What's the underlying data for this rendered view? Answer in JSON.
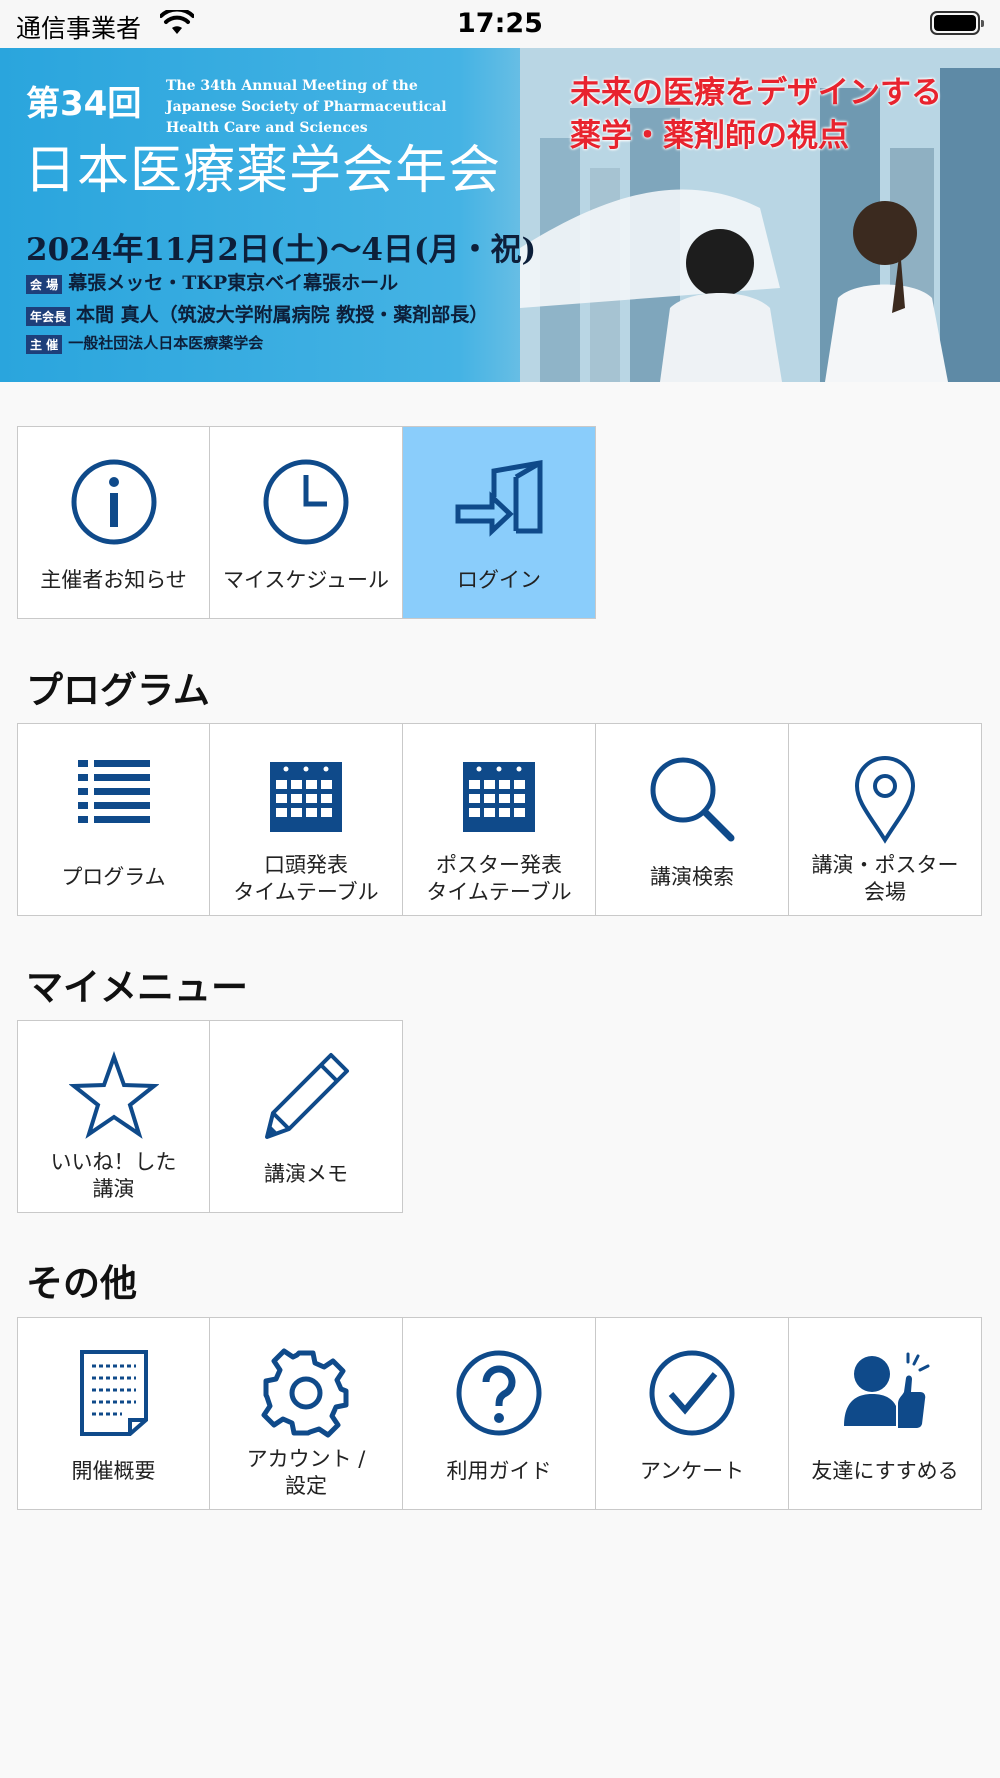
{
  "status_bar": {
    "carrier": "通信事業者",
    "time": "17:25"
  },
  "banner": {
    "edition": "第34回",
    "english_title": "The 34th Annual Meeting of the Japanese Society of Pharmaceutical Health Care and Sciences",
    "title": "日本医療薬学会年会",
    "date": "2024年11月2日(土)～4日(月・祝)",
    "venue_tag": "会 場",
    "venue": "幕張メッセ・TKP東京ベイ幕張ホール",
    "president_tag": "年会長",
    "president": "本間 真人（筑波大学附属病院 教授・薬剤部長）",
    "host_tag": "主 催",
    "host": "一般社団法人日本医療薬学会",
    "catch1": "未来の医療をデザインする",
    "catch2": "薬学・薬剤師の視点"
  },
  "top_menu": [
    {
      "label": "主催者お知らせ",
      "icon": "info-icon"
    },
    {
      "label": "マイスケジュール",
      "icon": "clock-icon"
    },
    {
      "label": "ログイン",
      "icon": "login-icon"
    }
  ],
  "sections": {
    "program": "プログラム",
    "my_menu": "マイメニュー",
    "other": "その他"
  },
  "program_items": [
    {
      "label": "プログラム",
      "icon": "list-icon"
    },
    {
      "label": "口頭発表\nタイムテーブル",
      "icon": "calendar-icon"
    },
    {
      "label": "ポスター発表\nタイムテーブル",
      "icon": "calendar-icon"
    },
    {
      "label": "講演検索",
      "icon": "search-icon"
    },
    {
      "label": "講演・ポスター\n会場",
      "icon": "map-pin-icon"
    }
  ],
  "my_menu_items": [
    {
      "label": "いいね！した\n講演",
      "icon": "star-icon"
    },
    {
      "label": "講演メモ",
      "icon": "pencil-icon"
    }
  ],
  "other_items": [
    {
      "label": "開催概要",
      "icon": "document-icon"
    },
    {
      "label": "アカウント /\n設定",
      "icon": "gear-icon"
    },
    {
      "label": "利用ガイド",
      "icon": "help-icon"
    },
    {
      "label": "アンケート",
      "icon": "check-circle-icon"
    },
    {
      "label": "友達にすすめる",
      "icon": "recommend-icon"
    }
  ],
  "colors": {
    "icon": "#0f4a8a",
    "active_tile": "#8acdfb",
    "banner_blue": "#2aa5dd",
    "catch_red": "#e8232e"
  }
}
